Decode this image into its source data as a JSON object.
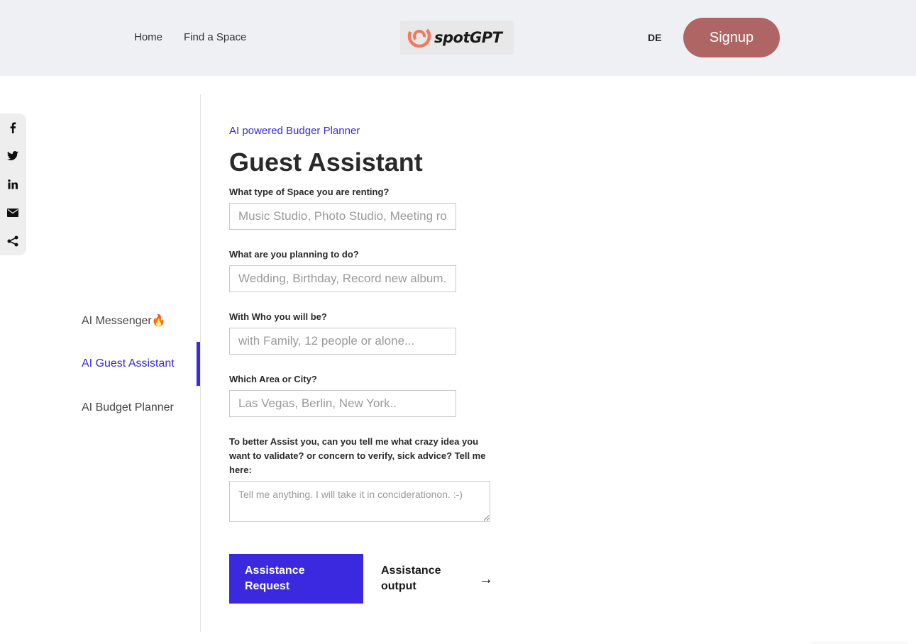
{
  "header": {
    "nav": [
      {
        "label": "Home"
      },
      {
        "label": "Find a Space"
      }
    ],
    "logo_text": "spotGPT",
    "lang": "DE",
    "signup_label": "Signup",
    "logo_colors": {
      "swirl": "#f07a5e"
    }
  },
  "share": {
    "items": [
      {
        "icon": "facebook-icon",
        "glyph": "f"
      },
      {
        "icon": "twitter-icon",
        "glyph": "🐦"
      },
      {
        "icon": "linkedin-icon",
        "glyph": "in"
      },
      {
        "icon": "email-icon",
        "glyph": "✉"
      },
      {
        "icon": "share-icon",
        "glyph": "<"
      }
    ]
  },
  "sidebar": {
    "items": [
      {
        "label": "AI Messenger🔥"
      },
      {
        "label": "AI Guest Assistant",
        "active": true
      },
      {
        "label": "AI Budget Planner"
      }
    ]
  },
  "main": {
    "eyebrow": "AI powered Budger Planner",
    "title": "Guest Assistant",
    "fields": [
      {
        "label": "What type of Space you are renting?",
        "placeholder": "Music Studio, Photo Studio, Meeting room...",
        "value": ""
      },
      {
        "label": "What are you planning to do?",
        "placeholder": "Wedding, Birthday, Record new album...",
        "value": ""
      },
      {
        "label": "With Who you will be?",
        "placeholder": "with Family, 12 people or alone...",
        "value": ""
      },
      {
        "label": "Which Area or City?",
        "placeholder": "Las Vegas, Berlin, New York..",
        "value": ""
      }
    ],
    "textarea": {
      "label": "To better Assist you, can you tell me what crazy idea you want to validate? or concern to verify, sick advice? Tell me here:",
      "placeholder": "Tell me anything. I will take it in conciderationon. :-)"
    },
    "buttons": {
      "request": "Assistance Request",
      "output": "Assistance output",
      "output_arrow": "→"
    }
  },
  "colors": {
    "accent": "#3b29d9",
    "signup": "#b06565",
    "header_bg": "#eff0f4"
  }
}
